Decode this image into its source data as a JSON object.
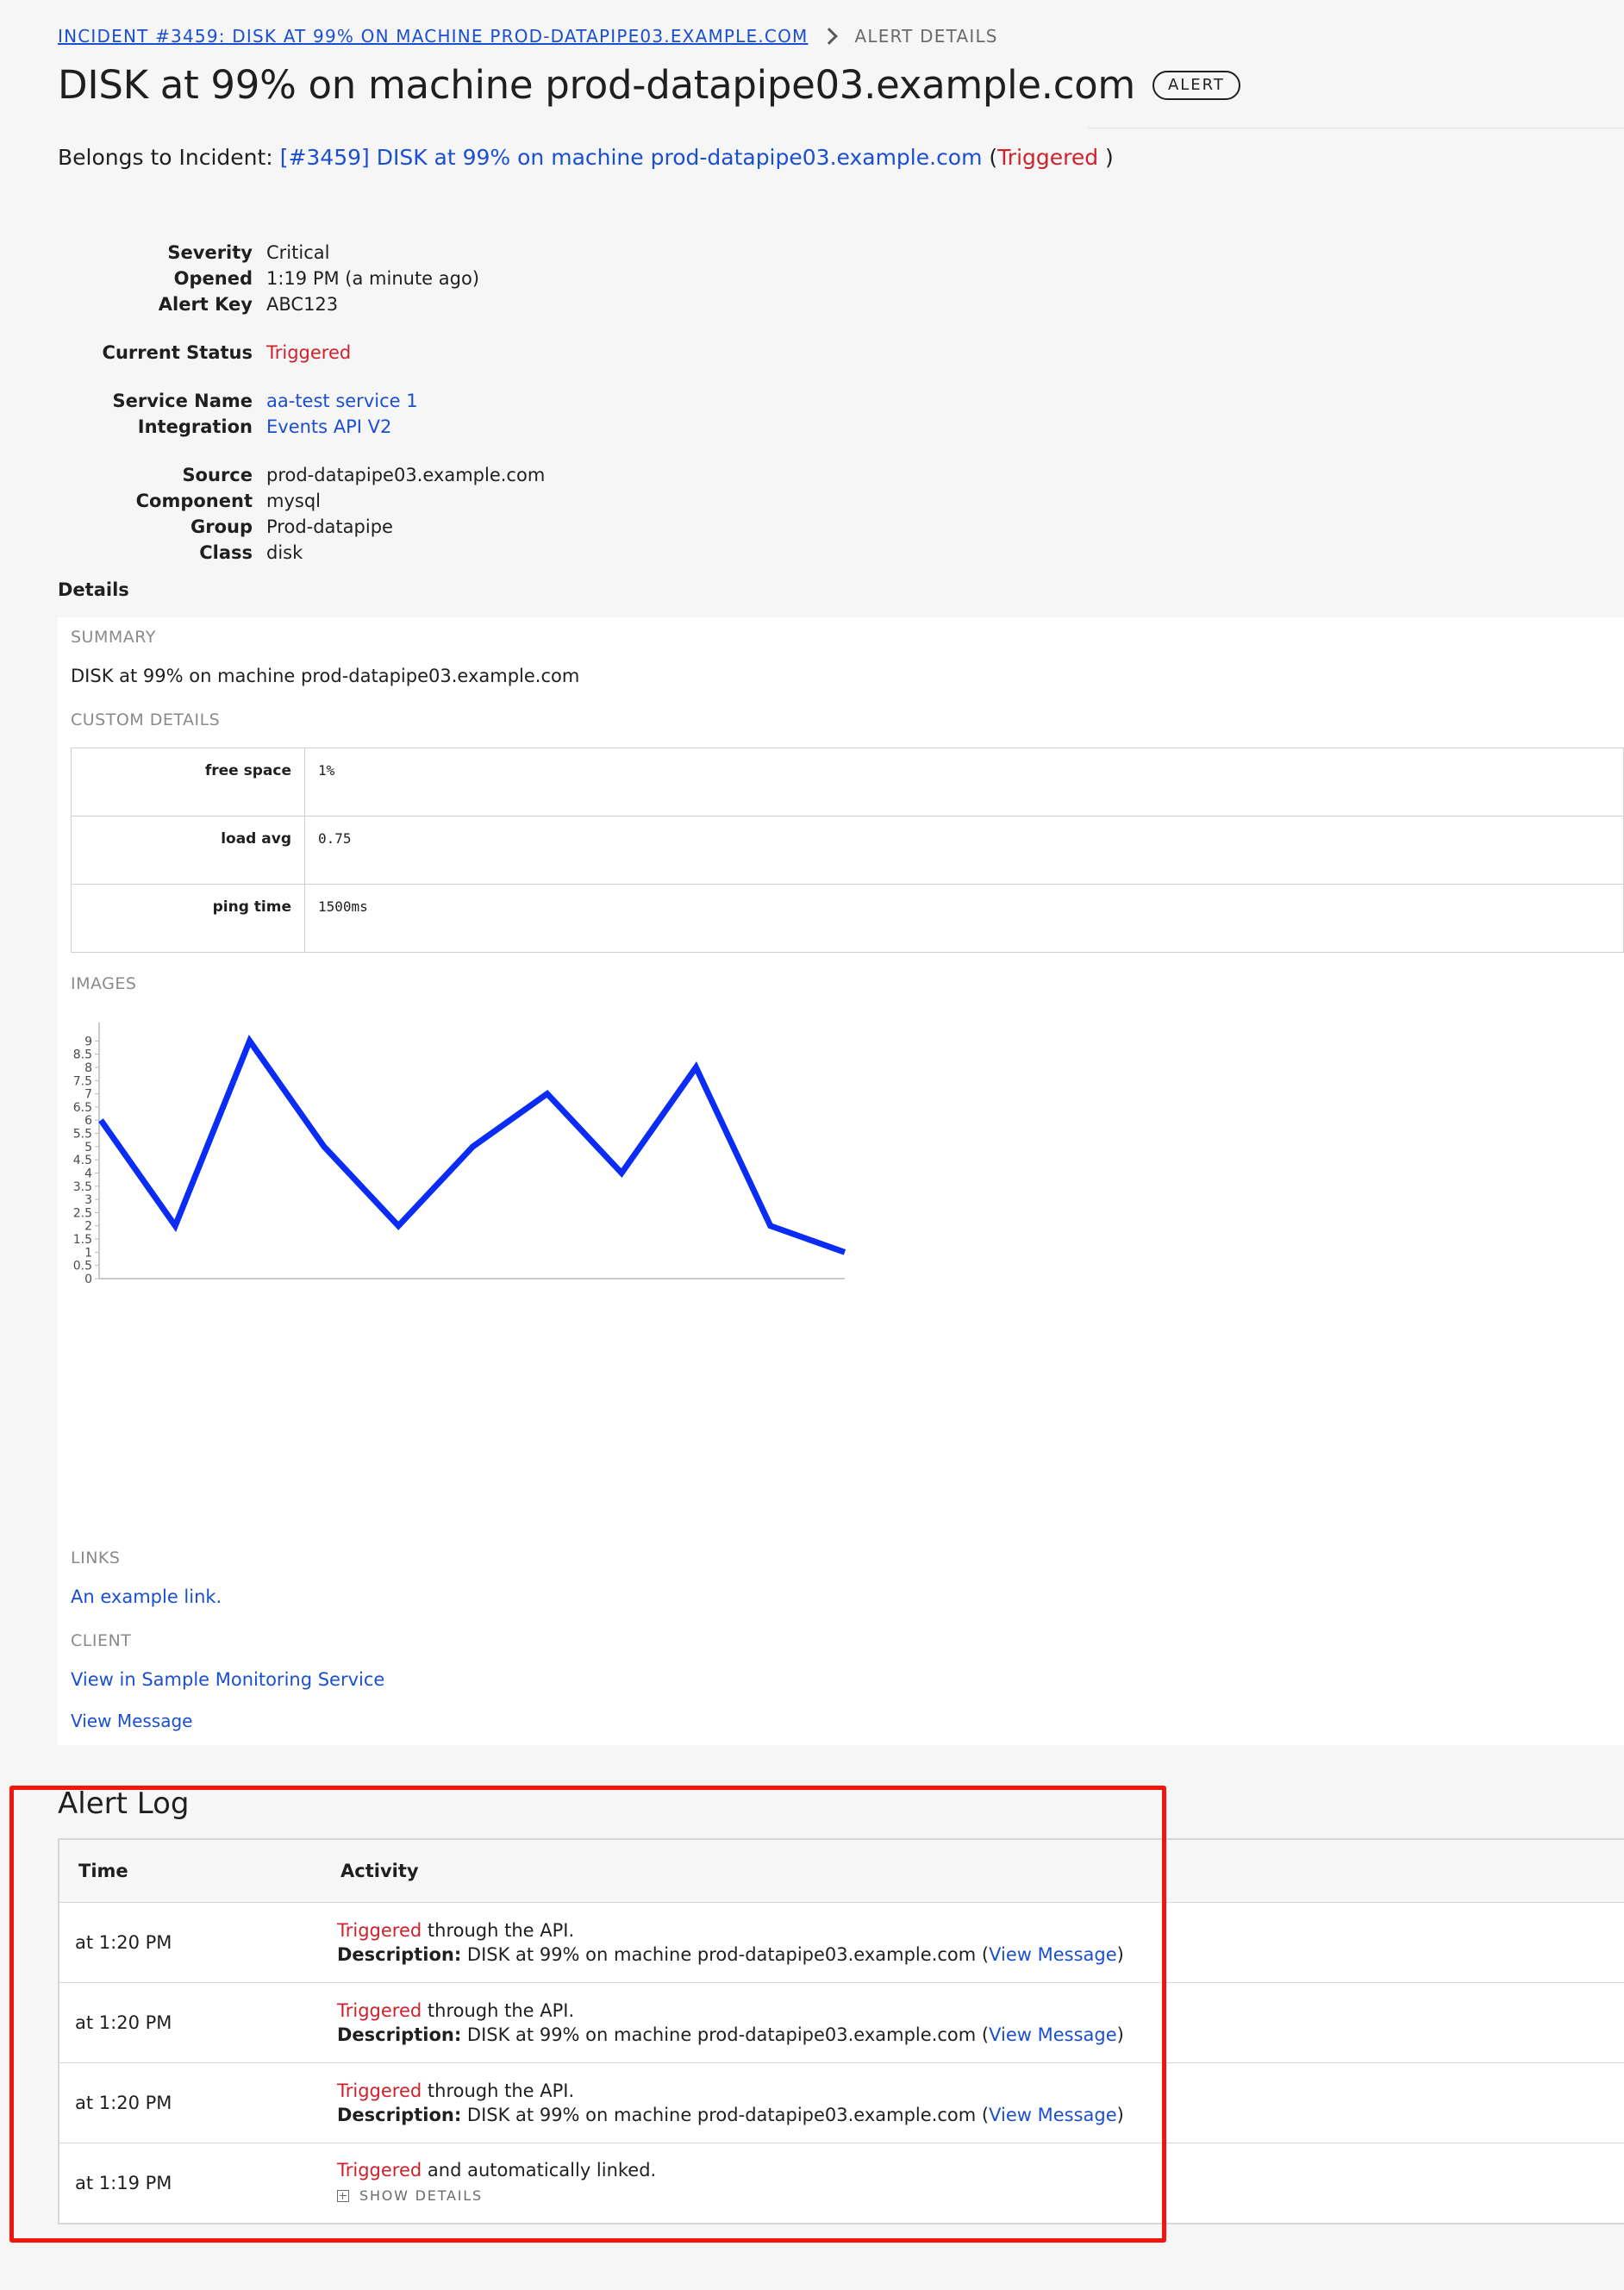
{
  "breadcrumb": {
    "incident_link": "INCIDENT #3459: DISK AT 99% ON MACHINE PROD-DATAPIPE03.EXAMPLE.COM",
    "current": "ALERT DETAILS"
  },
  "header": {
    "title": "DISK at 99% on machine prod-datapipe03.example.com",
    "badge": "ALERT",
    "belongs_prefix": "Belongs to Incident:",
    "incident_link": "[#3459] DISK at 99% on machine prod-datapipe03.example.com",
    "incident_status": "Triggered"
  },
  "fields": {
    "severity_label": "Severity",
    "severity": "Critical",
    "opened_label": "Opened",
    "opened": "1:19 PM (a minute ago)",
    "alert_key_label": "Alert Key",
    "alert_key": "ABC123",
    "status_label": "Current Status",
    "status": "Triggered",
    "service_label": "Service Name",
    "service": "aa-test service 1",
    "integration_label": "Integration",
    "integration": "Events API V2",
    "source_label": "Source",
    "source": "prod-datapipe03.example.com",
    "component_label": "Component",
    "component": "mysql",
    "group_label": "Group",
    "group": "Prod-datapipe",
    "class_label": "Class",
    "class": "disk"
  },
  "details": {
    "heading": "Details",
    "summary_label": "SUMMARY",
    "summary": "DISK at 99% on machine prod-datapipe03.example.com",
    "custom_label": "CUSTOM DETAILS",
    "custom": [
      {
        "key": "free space",
        "value": "1%"
      },
      {
        "key": "load avg",
        "value": "0.75"
      },
      {
        "key": "ping time",
        "value": "1500ms"
      }
    ],
    "images_label": "IMAGES",
    "links_label": "LINKS",
    "link": "An example link.",
    "client_label": "CLIENT",
    "client_link": "View in Sample Monitoring Service",
    "view_message": "View Message"
  },
  "chart_data": {
    "type": "line",
    "x": [
      0,
      1,
      2,
      3,
      4,
      5,
      6,
      7,
      8,
      9,
      10
    ],
    "series": [
      {
        "values": [
          6,
          2,
          9,
          5,
          2,
          5,
          7,
          4,
          8,
          2,
          1
        ]
      }
    ],
    "y_ticks": [
      "0",
      "0.5",
      "1",
      "1.5",
      "2",
      "2.5",
      "3",
      "3.5",
      "4",
      "4.5",
      "5",
      "5.5",
      "6",
      "6.5",
      "7",
      "7.5",
      "8",
      "8.5",
      "9"
    ],
    "ylim": [
      0,
      9.5
    ],
    "line_color": "#0a2cf5",
    "grid": false
  },
  "log": {
    "title": "Alert Log",
    "col_time": "Time",
    "col_activity": "Activity",
    "rows": [
      {
        "time": "at 1:20 PM",
        "status": "Triggered",
        "text": " through the API.",
        "desc_label": "Description:",
        "desc": " DISK at 99% on machine prod-datapipe03.example.com (",
        "link": "View Message",
        "close": ")"
      },
      {
        "time": "at 1:20 PM",
        "status": "Triggered",
        "text": " through the API.",
        "desc_label": "Description:",
        "desc": " DISK at 99% on machine prod-datapipe03.example.com (",
        "link": "View Message",
        "close": ")"
      },
      {
        "time": "at 1:20 PM",
        "status": "Triggered",
        "text": " through the API.",
        "desc_label": "Description:",
        "desc": " DISK at 99% on machine prod-datapipe03.example.com (",
        "link": "View Message",
        "close": ")"
      }
    ],
    "last_row": {
      "time": "at 1:19 PM",
      "status": "Triggered",
      "text": " and automatically linked.",
      "show_details": "SHOW DETAILS"
    }
  },
  "colors": {
    "link": "#1b4fd1",
    "triggered": "#d0212b",
    "highlight": "#f2160f"
  }
}
